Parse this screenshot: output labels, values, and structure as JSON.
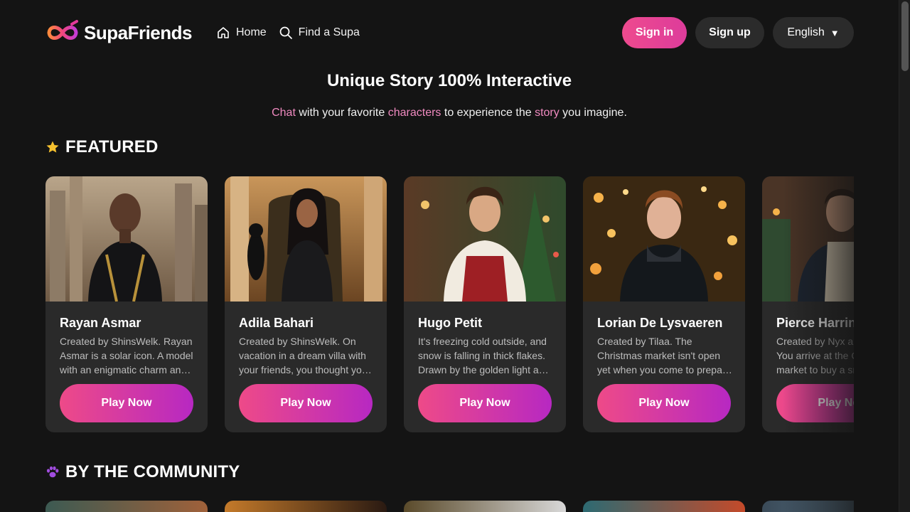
{
  "brand": {
    "name": "SupaFriends",
    "logo_icon": "infinity-logo-icon"
  },
  "nav": [
    {
      "label": "Home",
      "icon": "home-icon"
    },
    {
      "label": "Find a Supa",
      "icon": "search-icon"
    }
  ],
  "auth": {
    "signin_label": "Sign in",
    "signup_label": "Sign up"
  },
  "language": {
    "selected": "English",
    "caret": "▼"
  },
  "hero": {
    "title": "Unique Story 100% Interactive",
    "sub_w1": "Chat",
    "sub_t1": " with your favorite ",
    "sub_w2": "characters",
    "sub_t2": " to experience the ",
    "sub_w3": "story",
    "sub_t3": " you imagine."
  },
  "featured": {
    "heading": "FEATURED",
    "icon": "star-icon",
    "cards": [
      {
        "name": "Rayan Asmar",
        "description": "Created by ShinsWelk. Rayan Asmar is a solar icon. A model with an enigmatic charm and a gaze that holds a thousand secrets...",
        "button": "Play Now"
      },
      {
        "name": "Adila Bahari",
        "description": "Created by ShinsWelk. On vacation in a dream villa with your friends, you thought you would finally get some rest...",
        "button": "Play Now"
      },
      {
        "name": "Hugo Petit",
        "description": "It's freezing cold outside, and snow is falling in thick flakes. Drawn by the golden light and the smell of warm bread...",
        "button": "Play Now"
      },
      {
        "name": "Lorian De Lysvaeren",
        "description": "Created by Tilaa. The Christmas market isn't open yet when you come to prepare your stand among the lights...",
        "button": "Play Now"
      },
      {
        "name": "Pierce Harrington",
        "description": "Created by Nyx and friends. You arrive at the Christmas market to buy a small gift for someone special...",
        "button": "Play Now"
      }
    ]
  },
  "community": {
    "heading": "BY THE COMMUNITY",
    "icon": "paw-icon"
  },
  "colors": {
    "accent_pink": "#ee4a8e",
    "accent_purple": "#b728c2",
    "highlight_text": "#f08ac0",
    "background": "#141414",
    "card": "#2a2a2a"
  }
}
